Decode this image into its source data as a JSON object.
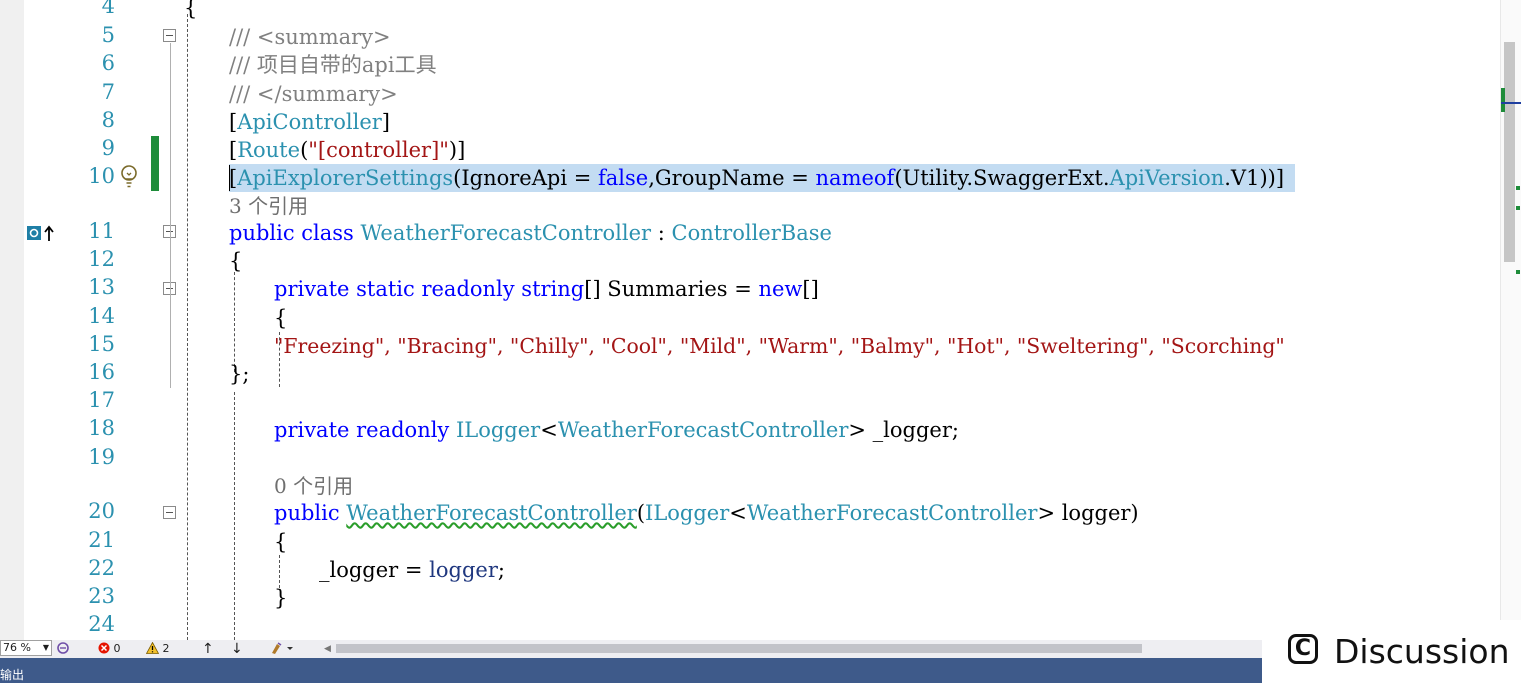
{
  "gutter": {
    "line_numbers": [
      "4",
      "5",
      "6",
      "7",
      "8",
      "9",
      "10",
      "11",
      "12",
      "13",
      "14",
      "15",
      "16",
      "17",
      "18",
      "19",
      "20",
      "21",
      "22",
      "23",
      "24"
    ]
  },
  "code": {
    "l4": "{",
    "l5": "/// <summary>",
    "l6": "/// 项目自带的api工具",
    "l7": "/// </summary>",
    "l8a": "[",
    "l8b": "ApiController",
    "l8c": "]",
    "l9a": "[",
    "l9b": "Route",
    "l9c": "(",
    "l9d": "\"[controller]\"",
    "l9e": ")]",
    "l10a": "[",
    "l10b": "ApiExplorerSettings",
    "l10c": "(IgnoreApi = ",
    "l10d": "false",
    "l10e": ",GroupName = ",
    "l10f": "nameof",
    "l10g": "(Utility.SwaggerExt.",
    "l10h": "ApiVersion",
    "l10i": ".V1))]",
    "lens10": "3 个引用",
    "l11a": "public class ",
    "l11b": "WeatherForecastController",
    "l11c": " : ",
    "l11d": "ControllerBase",
    "l12": "{",
    "l13a": "private static readonly string",
    "l13b": "[] Summaries = ",
    "l13c": "new",
    "l13d": "[]",
    "l14": "{",
    "l15_items": [
      "\"Freezing\"",
      "\"Bracing\"",
      "\"Chilly\"",
      "\"Cool\"",
      "\"Mild\"",
      "\"Warm\"",
      "\"Balmy\"",
      "\"Hot\"",
      "\"Sweltering\"",
      "\"Scorching\""
    ],
    "l15": "\"Freezing\", \"Bracing\", \"Chilly\", \"Cool\", \"Mild\", \"Warm\", \"Balmy\", \"Hot\", \"Sweltering\", \"Scorching\"",
    "l16": "};",
    "l18a": "private readonly ",
    "l18b": "ILogger",
    "l18c": "<",
    "l18d": "WeatherForecastController",
    "l18e": "> _logger;",
    "lens19": "0 个引用",
    "l20a": "public ",
    "l20b": "WeatherForecastController",
    "l20c": "(",
    "l20d": "ILogger",
    "l20e": "<",
    "l20f": "WeatherForecastController",
    "l20g": "> logger)",
    "l21": "{",
    "l22a": "_logger = ",
    "l22b": "logger",
    "l22c": ";",
    "l23": "}"
  },
  "statusbar": {
    "zoom": "76 %",
    "errors": "0",
    "warnings": "2",
    "up_arrow": "↑",
    "down_arrow": "↓"
  },
  "output_tab": "输出",
  "watermark": {
    "logo_letter": "C",
    "text": "Discussion"
  },
  "colors": {
    "keyword": "#0000ff",
    "type": "#2b91af",
    "string": "#a31515",
    "comment": "#808080",
    "change_bar": "#1e8c3a",
    "selection": "#c3dcf2"
  }
}
